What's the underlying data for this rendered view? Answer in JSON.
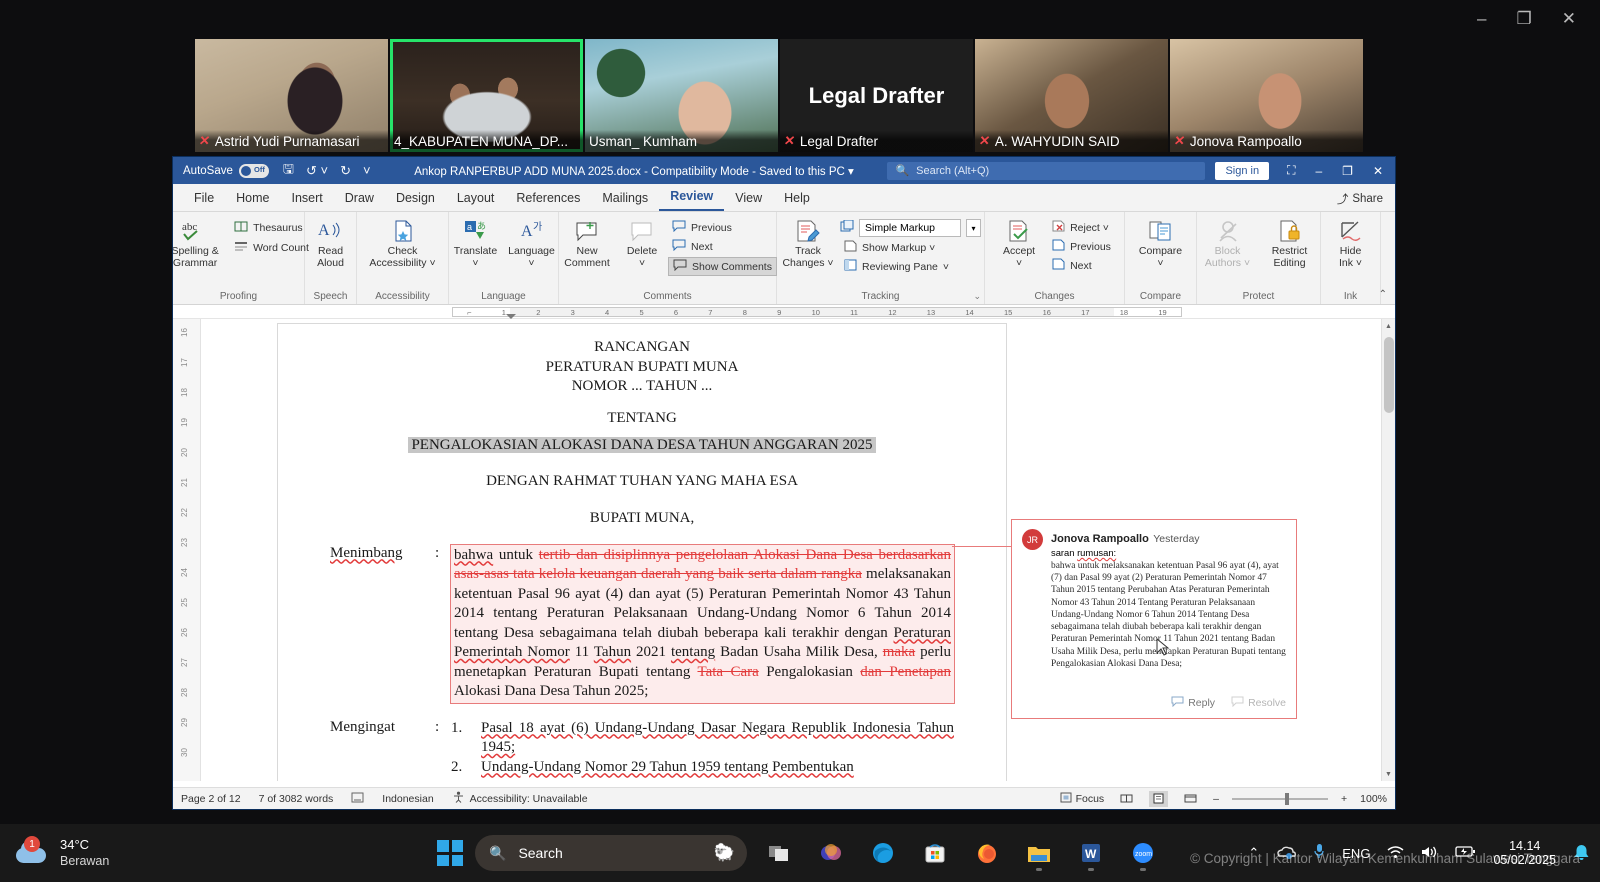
{
  "zoom_window": {
    "controls": {
      "minimize": "–",
      "maximize": "❐",
      "close": "✕"
    },
    "participants": [
      {
        "name": "Astrid Yudi Purnamasari",
        "muted": true,
        "active": false,
        "placeholder": false
      },
      {
        "name": "4_KABUPATEN MUNA_DP...",
        "muted": false,
        "active": true,
        "placeholder": false
      },
      {
        "name": "Usman_ Kumham",
        "muted": false,
        "active": false,
        "placeholder": false
      },
      {
        "name": "Legal Drafter",
        "muted": true,
        "active": false,
        "placeholder": true,
        "placeholder_text": "Legal Drafter"
      },
      {
        "name": "A. WAHYUDIN SAID",
        "muted": true,
        "active": false,
        "placeholder": false
      },
      {
        "name": "Jonova Rampoallo",
        "muted": true,
        "active": false,
        "placeholder": false
      }
    ]
  },
  "word": {
    "titlebar": {
      "autosave_label": "AutoSave",
      "autosave_state": "Off",
      "save_icon": "save-icon",
      "undo_icon": "undo-icon",
      "redo_icon": "redo-icon",
      "customize_icon": "chevron-down-icon",
      "document_title": "Ankop RANPERBUP ADD MUNA 2025.docx  -  Compatibility Mode  -  Saved to this PC  ▾",
      "search_placeholder": "Search (Alt+Q)",
      "sign_in": "Sign in",
      "ribbon_display_icon": "ribbon-display-icon",
      "minimize": "–",
      "restore": "❐",
      "close": "✕"
    },
    "tabs": [
      {
        "label": "File",
        "selected": false
      },
      {
        "label": "Home",
        "selected": false
      },
      {
        "label": "Insert",
        "selected": false
      },
      {
        "label": "Draw",
        "selected": false
      },
      {
        "label": "Design",
        "selected": false
      },
      {
        "label": "Layout",
        "selected": false
      },
      {
        "label": "References",
        "selected": false
      },
      {
        "label": "Mailings",
        "selected": false
      },
      {
        "label": "Review",
        "selected": true
      },
      {
        "label": "View",
        "selected": false
      },
      {
        "label": "Help",
        "selected": false
      }
    ],
    "share_label": "Share",
    "ribbon": {
      "proofing": {
        "caption": "Proofing",
        "spelling_grammar": "Spelling &\nGrammar",
        "spelling_abc": "abc",
        "thesaurus": "Thesaurus",
        "word_count": "Word Count"
      },
      "speech": {
        "caption": "Speech",
        "read_aloud": "Read\nAloud"
      },
      "accessibility": {
        "caption": "Accessibility",
        "check_accessibility": "Check\nAccessibility ˅"
      },
      "language": {
        "caption": "Language",
        "translate": "Translate\n˅",
        "language": "Language\n˅"
      },
      "comments": {
        "caption": "Comments",
        "new_comment": "New\nComment",
        "delete": "Delete\n˅",
        "previous": "Previous",
        "next": "Next",
        "show_comments": "Show Comments",
        "show_comments_pressed": true
      },
      "tracking": {
        "caption": "Tracking",
        "track_changes": "Track\nChanges ˅",
        "markup_mode": "Simple Markup",
        "show_markup": "Show Markup ˅",
        "reviewing_pane": "Reviewing Pane",
        "dialog_launcher": "⌄"
      },
      "changes": {
        "caption": "Changes",
        "accept": "Accept\n˅",
        "reject": "Reject  ˅",
        "previous": "Previous",
        "next": "Next"
      },
      "compare": {
        "caption": "Compare",
        "compare": "Compare\n˅"
      },
      "protect": {
        "caption": "Protect",
        "block_authors": "Block\nAuthors ˅",
        "block_authors_disabled": true,
        "restrict_editing": "Restrict\nEditing"
      },
      "ink": {
        "caption": "Ink",
        "hide_ink": "Hide\nInk ˅"
      },
      "collapse_icon": "chevron-up-icon"
    },
    "ruler": {
      "ticks": [
        "⌐",
        "1",
        "2",
        "3",
        "4",
        "5",
        "6",
        "7",
        "8",
        "9",
        "10",
        "11",
        "12",
        "13",
        "14",
        "15",
        "16",
        "17",
        "18",
        "19"
      ],
      "vertical_ticks": [
        "16",
        "17",
        "18",
        "19",
        "20",
        "21",
        "22",
        "23",
        "24",
        "25",
        "26",
        "27",
        "28",
        "29",
        "30"
      ]
    },
    "document": {
      "heading_lines": [
        "RANCANGAN",
        "PERATURAN BUPATI MUNA",
        "NOMOR ... TAHUN ..."
      ],
      "tentang": "TENTANG",
      "subject_highlighted": "PENGALOKASIAN ALOKASI DANA DESA TAHUN ANGGARAN 2025",
      "rahmat": "DENGAN RAHMAT TUHAN YANG MAHA ESA",
      "bupati": "BUPATI MUNA,",
      "menimbang_label": "Menimbang",
      "menimbang_colon": ":",
      "menimbang_parts": [
        {
          "t": "bahwa",
          "style": "spell"
        },
        {
          "t": " untuk ",
          "style": "plain"
        },
        {
          "t": "tertib dan disiplinnya pengelolaan Alokasi Dana Desa berdasarkan asas-asas tata kelola keuangan daerah yang baik serta dalam rangka",
          "style": "deleted"
        },
        {
          "t": " melaksanakan ketentuan Pasal 96 ayat (4) dan ayat (5) Peraturan Pemerintah Nomor 43 Tahun 2014 tentang Peraturan Pelaksanaan Undang-Undang Nomor 6 Tahun 2014 tentang Desa sebagaimana telah diubah beberapa kali terakhir dengan ",
          "style": "plain"
        },
        {
          "t": "Peraturan Pemerintah Nomor",
          "style": "spell"
        },
        {
          "t": " 11 ",
          "style": "plain"
        },
        {
          "t": "Tahun",
          "style": "spell"
        },
        {
          "t": " 2021 ",
          "style": "plain"
        },
        {
          "t": "tentang",
          "style": "spell"
        },
        {
          "t": " Badan Usaha Milik Desa, ",
          "style": "plain"
        },
        {
          "t": "maka",
          "style": "deleted"
        },
        {
          "t": " perlu menetapkan Peraturan Bupati tentang ",
          "style": "plain"
        },
        {
          "t": "Tata Cara",
          "style": "deleted"
        },
        {
          "t": " Pengalokasian ",
          "style": "plain"
        },
        {
          "t": "dan Penetapan",
          "style": "deleted"
        },
        {
          "t": " Alokasi Dana Desa Tahun 2025;",
          "style": "plain"
        }
      ],
      "mengingat_label": "Mengingat",
      "mengingat_colon": ":",
      "mengingat_items": [
        {
          "n": "1.",
          "text": "Pasal 18 ayat (6) Undang-Undang Dasar Negara Republik Indonesia Tahun 1945;"
        },
        {
          "n": "2.",
          "text": "Undang-Undang Nomor 29 Tahun 1959 tentang Pembentukan"
        }
      ]
    },
    "comment": {
      "author_initials": "JR",
      "author": "Jonova Rampoallo",
      "time": "Yesterday",
      "prefix_plain": "saran ",
      "prefix_spell": "rumusan:",
      "body": "bahwa untuk melaksanakan ketentuan Pasal 96 ayat (4), ayat (7) dan Pasal 99 ayat (2) Peraturan Pemerintah Nomor 47 Tahun 2015 tentang Perubahan Atas Peraturan Pemerintah Nomor 43 Tahun 2014 Tentang Peraturan Pelaksanaan Undang-Undang Nomor 6 Tahun 2014 Tentang Desa sebagaimana telah diubah beberapa kali terakhir dengan Peraturan Pemerintah Nomor 11 Tahun 2021 tentang Badan Usaha Milik Desa, perlu menetapkan Peraturan Bupati tentang Pengalokasian Alokasi Dana Desa;",
      "reply": "Reply",
      "resolve": "Resolve"
    },
    "status_bar": {
      "page": "Page 2 of 12",
      "words": "7 of 3082 words",
      "proof_icon": "proofing-errors-icon",
      "language": "Indonesian",
      "accessibility_icon": "accessibility-icon",
      "accessibility": "Accessibility: Unavailable",
      "focus": "Focus",
      "view_read": "read-mode-icon",
      "view_print": "print-layout-icon",
      "view_web": "web-layout-icon",
      "zoom_out": "–",
      "zoom_in": "+",
      "zoom_level": "100%"
    }
  },
  "taskbar": {
    "weather": {
      "temp": "34°C",
      "condition": "Berawan",
      "badge": "1",
      "icon": "cloud-icon"
    },
    "start_icon": "windows-start-icon",
    "search": {
      "icon": "search-icon",
      "placeholder": "Search",
      "mascot": "sheep-icon"
    },
    "apps": [
      {
        "name": "task-view-icon",
        "glyph": "▣",
        "running": false
      },
      {
        "name": "copilot-icon",
        "glyph": "◓",
        "running": false
      },
      {
        "name": "edge-icon",
        "glyph": "◉",
        "running": false
      },
      {
        "name": "microsoft-store-icon",
        "glyph": "▤",
        "running": false
      },
      {
        "name": "firefox-icon",
        "glyph": "◍",
        "running": false
      },
      {
        "name": "file-explorer-icon",
        "glyph": "🗀",
        "running": true
      },
      {
        "name": "word-icon",
        "glyph": "W",
        "running": true
      },
      {
        "name": "zoom-icon",
        "glyph": "zoom",
        "running": true
      }
    ],
    "tray": {
      "chevron": "show-hidden-icons",
      "onedrive": "onedrive-icon",
      "mic": "microphone-icon",
      "language": "ENG",
      "wifi": "wifi-icon",
      "volume": "volume-icon",
      "battery": "battery-charging-icon",
      "time": "14.14",
      "date": "05/02/2025",
      "notifications": "bell-icon"
    }
  },
  "watermark": "© Copyright | Kantor Wilayah Kemenkumham Sulawesi Tenggara"
}
